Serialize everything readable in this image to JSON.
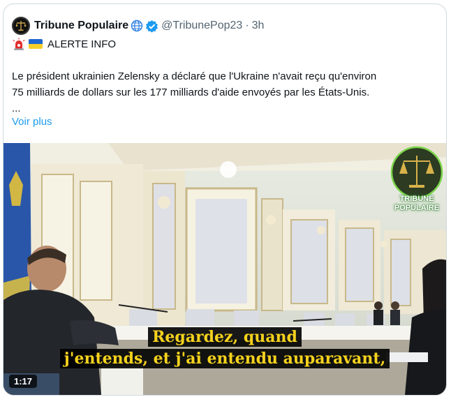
{
  "tweet": {
    "author_name": "Tribune Populaire",
    "handle": "@TribunePop23",
    "separator": "·",
    "time": "3h",
    "alert_label": "ALERTE INFO",
    "body_line1": "Le président ukrainien Zelensky a déclaré que l'Ukraine n'avait reçu qu'environ",
    "body_line2": "75 milliards de dollars sur les 177 milliards d'aide envoyés par les États-Unis.",
    "ellipsis": "...",
    "show_more": "Voir plus"
  },
  "media": {
    "duration": "1:17",
    "subtitle_line1": "Regardez, quand",
    "subtitle_line2": "j'entends, et j'ai entendu auparavant,",
    "watermark_line1": "TRIBUNE",
    "watermark_line2": "POPULAIRE"
  },
  "colors": {
    "link": "#1d9bf0",
    "verified": "#1d9bf0",
    "muted": "#536471",
    "subtitle": "#f5d21d"
  },
  "icons": [
    "scales-avatar-icon",
    "globe-icon",
    "verified-badge-icon",
    "siren-icon",
    "ukraine-flag-icon"
  ]
}
